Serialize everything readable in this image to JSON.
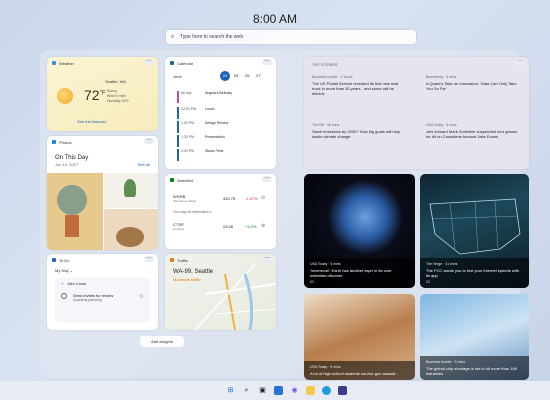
{
  "header": {
    "time": "8:00 AM",
    "search_placeholder": "Type here to search the web"
  },
  "weather": {
    "title": "Weather",
    "location": "Seattle, WA",
    "temp": "72",
    "unit": "°F",
    "detail_1": "Sunny",
    "detail_2": "Wind 5 mph",
    "detail_3": "Humidity 42%",
    "link": "See full forecast"
  },
  "photos": {
    "title": "Photos",
    "heading": "On This Day",
    "date": "Jun 14, 2017",
    "see_all": "See all"
  },
  "todo": {
    "title": "To Do",
    "list": "My Day",
    "add_task": "Add a task",
    "task": "Send invites for review",
    "task_sub": "Quarterly planning"
  },
  "calendar": {
    "title": "Calendar",
    "month": "June",
    "days": [
      "24",
      "25",
      "26",
      "27"
    ],
    "events": [
      {
        "time": "All day",
        "name": "Angela's Birthday",
        "color": "#c04aa0"
      },
      {
        "time": "12:00 PM",
        "name": "Lunch",
        "color": "#1e5fb3"
      },
      {
        "time": "1:00 PM",
        "name": "Design Review",
        "color": "#1e5fb3"
      },
      {
        "time": "1:30 PM",
        "name": "Presentation",
        "color": "#1e5fb3"
      },
      {
        "time": "3:00 PM",
        "name": "Studio Time",
        "color": "#1e5fb3"
      }
    ]
  },
  "watchlist": {
    "title": "Watchlist",
    "stocks": [
      {
        "symbol": "WGRB",
        "sub": "Woodgrove Bank",
        "price": "432.75",
        "change": "-1.67%",
        "color": "#d13438"
      }
    ],
    "note": "You may be interested in",
    "stocks2": [
      {
        "symbol": "CTSP",
        "sub": "Contoso",
        "price": "23.08",
        "change": "+3.2%",
        "color": "#107c10"
      }
    ]
  },
  "traffic": {
    "title": "Traffic",
    "location": "WA-99, Seattle",
    "status": "Moderate traffic"
  },
  "add_widgets": "Add widgets",
  "top_stories": {
    "label": "TOP STORIES",
    "items": [
      {
        "source": "Business Insider · 2 hours",
        "headline": "The US Postal Service revealed its first new mail truck in more than 30 years - and some will be electric"
      },
      {
        "source": "Bloomberg · 3 mins",
        "headline": "A Quant's Take on Innovation: 'Data Can Only Take You So Far'"
      },
      {
        "source": "The Hill · 18 mins",
        "headline": "Slash emissions by 2030? How big goals will help tackle climate change"
      },
      {
        "source": "USA Today · 5 mins",
        "headline": "Jets forward Mark Scheifele suspended four games for hit on Canadiens forward Jake Evans"
      }
    ]
  },
  "news": [
    {
      "source": "USA Today · 5 mins",
      "headline": "'Innermost': Earth has another layer in its core, scientists discover",
      "reactions": "63"
    },
    {
      "source": "The Verge · 41 mins",
      "headline": "The FCC wants you to test your internet speeds with its app",
      "reactions": "22"
    },
    {
      "source": "USA Today · 5 mins",
      "headline": "A lot of high school students survive gun assault...",
      "reactions": "78"
    },
    {
      "source": "Business Insider · 9 mins",
      "headline": "The global chip shortage is set to hit more than 169 industries",
      "reactions": "52"
    }
  ]
}
